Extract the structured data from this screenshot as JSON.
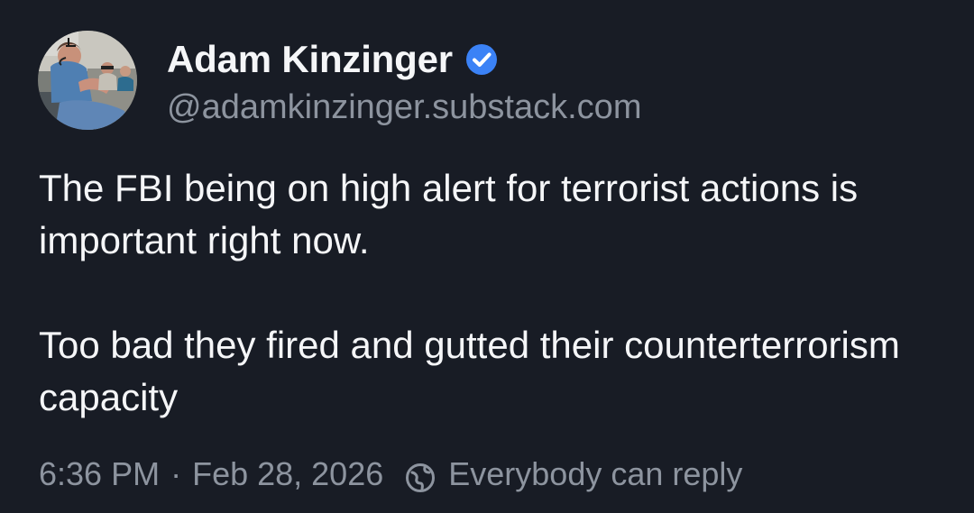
{
  "post": {
    "author": {
      "display_name": "Adam Kinzinger",
      "handle": "@adamkinzinger.substack.com",
      "verified_icon": "verified-badge-icon",
      "avatar": "profile-photo"
    },
    "paragraphs": [
      "The FBI being on high alert for terrorist actions is important right now.",
      "Too bad they fired and gutted their counterterrorism capacity"
    ],
    "meta": {
      "time": "6:36 PM",
      "separator": "·",
      "date": "Feb 28, 2026",
      "reply_setting": "Everybody can reply",
      "reply_icon": "globe-icon"
    }
  },
  "colors": {
    "background": "#181c25",
    "primary_text": "#f5f6f8",
    "secondary_text": "#8d949f",
    "verified": "#3b82f6"
  }
}
